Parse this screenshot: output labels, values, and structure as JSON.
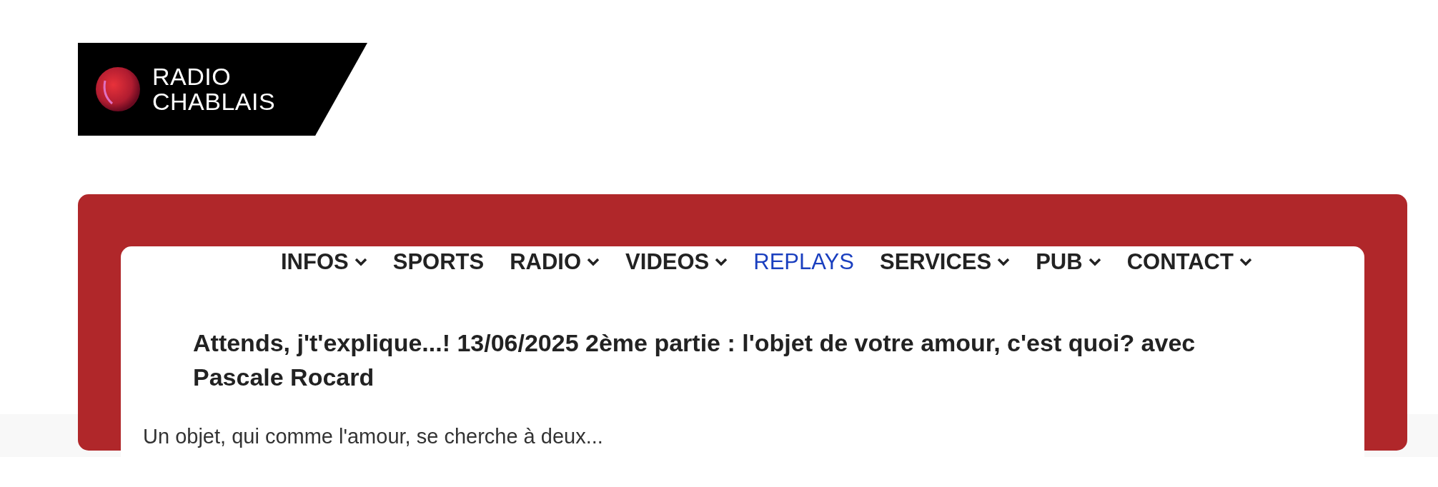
{
  "logo": {
    "line_1": "RADIO",
    "line_2": "CHABLAIS"
  },
  "nav": [
    {
      "label": "INFOS",
      "dropdown": true,
      "selected": false
    },
    {
      "label": "SPORTS",
      "dropdown": false,
      "selected": false
    },
    {
      "label": "RADIO",
      "dropdown": true,
      "selected": false
    },
    {
      "label": "VIDEOS",
      "dropdown": true,
      "selected": false
    },
    {
      "label": "REPLAYS",
      "dropdown": false,
      "selected": true
    },
    {
      "label": "SERVICES",
      "dropdown": true,
      "selected": false
    },
    {
      "label": "PUB",
      "dropdown": true,
      "selected": false
    },
    {
      "label": "CONTACT",
      "dropdown": true,
      "selected": false
    }
  ],
  "article": {
    "title": "Attends, j't'explique...! 13/06/2025 2ème partie : l'objet de votre amour, c'est quoi? avec Pascale Rocard",
    "summary": "Un objet, qui comme l'amour, se cherche à deux..."
  }
}
